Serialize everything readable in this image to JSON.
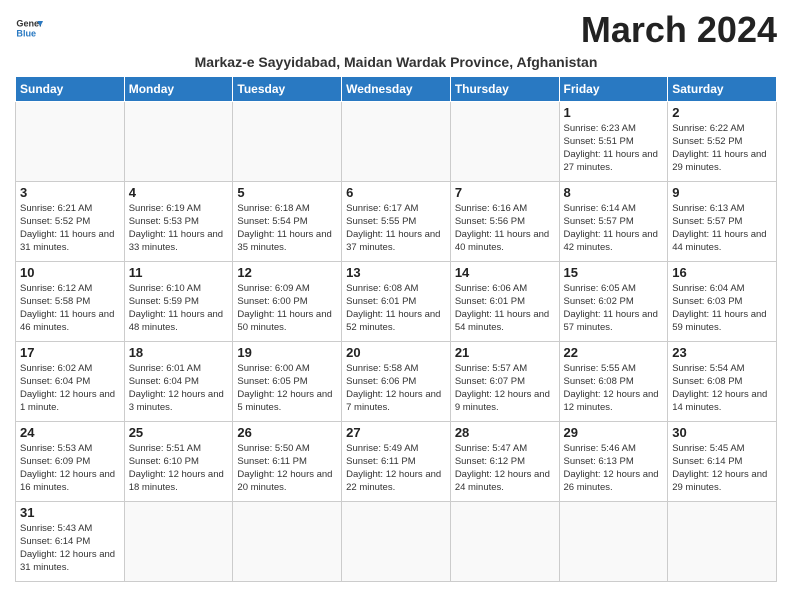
{
  "header": {
    "logo_line1": "General",
    "logo_line2": "Blue",
    "month_title": "March 2024",
    "subtitle": "Markaz-e Sayyidabad, Maidan Wardak Province, Afghanistan"
  },
  "weekdays": [
    "Sunday",
    "Monday",
    "Tuesday",
    "Wednesday",
    "Thursday",
    "Friday",
    "Saturday"
  ],
  "weeks": [
    [
      {
        "day": "",
        "info": ""
      },
      {
        "day": "",
        "info": ""
      },
      {
        "day": "",
        "info": ""
      },
      {
        "day": "",
        "info": ""
      },
      {
        "day": "",
        "info": ""
      },
      {
        "day": "1",
        "info": "Sunrise: 6:23 AM\nSunset: 5:51 PM\nDaylight: 11 hours and 27 minutes."
      },
      {
        "day": "2",
        "info": "Sunrise: 6:22 AM\nSunset: 5:52 PM\nDaylight: 11 hours and 29 minutes."
      }
    ],
    [
      {
        "day": "3",
        "info": "Sunrise: 6:21 AM\nSunset: 5:52 PM\nDaylight: 11 hours and 31 minutes."
      },
      {
        "day": "4",
        "info": "Sunrise: 6:19 AM\nSunset: 5:53 PM\nDaylight: 11 hours and 33 minutes."
      },
      {
        "day": "5",
        "info": "Sunrise: 6:18 AM\nSunset: 5:54 PM\nDaylight: 11 hours and 35 minutes."
      },
      {
        "day": "6",
        "info": "Sunrise: 6:17 AM\nSunset: 5:55 PM\nDaylight: 11 hours and 37 minutes."
      },
      {
        "day": "7",
        "info": "Sunrise: 6:16 AM\nSunset: 5:56 PM\nDaylight: 11 hours and 40 minutes."
      },
      {
        "day": "8",
        "info": "Sunrise: 6:14 AM\nSunset: 5:57 PM\nDaylight: 11 hours and 42 minutes."
      },
      {
        "day": "9",
        "info": "Sunrise: 6:13 AM\nSunset: 5:57 PM\nDaylight: 11 hours and 44 minutes."
      }
    ],
    [
      {
        "day": "10",
        "info": "Sunrise: 6:12 AM\nSunset: 5:58 PM\nDaylight: 11 hours and 46 minutes."
      },
      {
        "day": "11",
        "info": "Sunrise: 6:10 AM\nSunset: 5:59 PM\nDaylight: 11 hours and 48 minutes."
      },
      {
        "day": "12",
        "info": "Sunrise: 6:09 AM\nSunset: 6:00 PM\nDaylight: 11 hours and 50 minutes."
      },
      {
        "day": "13",
        "info": "Sunrise: 6:08 AM\nSunset: 6:01 PM\nDaylight: 11 hours and 52 minutes."
      },
      {
        "day": "14",
        "info": "Sunrise: 6:06 AM\nSunset: 6:01 PM\nDaylight: 11 hours and 54 minutes."
      },
      {
        "day": "15",
        "info": "Sunrise: 6:05 AM\nSunset: 6:02 PM\nDaylight: 11 hours and 57 minutes."
      },
      {
        "day": "16",
        "info": "Sunrise: 6:04 AM\nSunset: 6:03 PM\nDaylight: 11 hours and 59 minutes."
      }
    ],
    [
      {
        "day": "17",
        "info": "Sunrise: 6:02 AM\nSunset: 6:04 PM\nDaylight: 12 hours and 1 minute."
      },
      {
        "day": "18",
        "info": "Sunrise: 6:01 AM\nSunset: 6:04 PM\nDaylight: 12 hours and 3 minutes."
      },
      {
        "day": "19",
        "info": "Sunrise: 6:00 AM\nSunset: 6:05 PM\nDaylight: 12 hours and 5 minutes."
      },
      {
        "day": "20",
        "info": "Sunrise: 5:58 AM\nSunset: 6:06 PM\nDaylight: 12 hours and 7 minutes."
      },
      {
        "day": "21",
        "info": "Sunrise: 5:57 AM\nSunset: 6:07 PM\nDaylight: 12 hours and 9 minutes."
      },
      {
        "day": "22",
        "info": "Sunrise: 5:55 AM\nSunset: 6:08 PM\nDaylight: 12 hours and 12 minutes."
      },
      {
        "day": "23",
        "info": "Sunrise: 5:54 AM\nSunset: 6:08 PM\nDaylight: 12 hours and 14 minutes."
      }
    ],
    [
      {
        "day": "24",
        "info": "Sunrise: 5:53 AM\nSunset: 6:09 PM\nDaylight: 12 hours and 16 minutes."
      },
      {
        "day": "25",
        "info": "Sunrise: 5:51 AM\nSunset: 6:10 PM\nDaylight: 12 hours and 18 minutes."
      },
      {
        "day": "26",
        "info": "Sunrise: 5:50 AM\nSunset: 6:11 PM\nDaylight: 12 hours and 20 minutes."
      },
      {
        "day": "27",
        "info": "Sunrise: 5:49 AM\nSunset: 6:11 PM\nDaylight: 12 hours and 22 minutes."
      },
      {
        "day": "28",
        "info": "Sunrise: 5:47 AM\nSunset: 6:12 PM\nDaylight: 12 hours and 24 minutes."
      },
      {
        "day": "29",
        "info": "Sunrise: 5:46 AM\nSunset: 6:13 PM\nDaylight: 12 hours and 26 minutes."
      },
      {
        "day": "30",
        "info": "Sunrise: 5:45 AM\nSunset: 6:14 PM\nDaylight: 12 hours and 29 minutes."
      }
    ],
    [
      {
        "day": "31",
        "info": "Sunrise: 5:43 AM\nSunset: 6:14 PM\nDaylight: 12 hours and 31 minutes."
      },
      {
        "day": "",
        "info": ""
      },
      {
        "day": "",
        "info": ""
      },
      {
        "day": "",
        "info": ""
      },
      {
        "day": "",
        "info": ""
      },
      {
        "day": "",
        "info": ""
      },
      {
        "day": "",
        "info": ""
      }
    ]
  ]
}
